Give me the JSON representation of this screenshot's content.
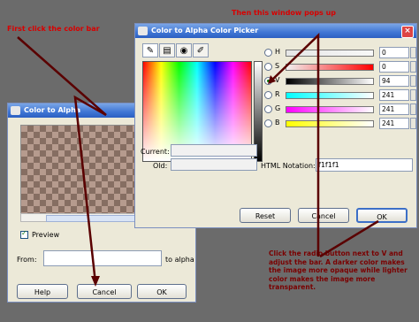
{
  "annotations": {
    "step1": "First click the color bar",
    "step2": "Then this window pops up",
    "step3": "Click the radio button next to V and adjust the bar. A darker color makes the image more opaque while lighter color makes the image more transparent."
  },
  "back_window": {
    "title": "Color to Alpha",
    "preview_label": "Preview",
    "from_label": "From:",
    "to_alpha_label": "to alpha",
    "help_button": "Help",
    "cancel_button": "Cancel",
    "ok_button": "OK"
  },
  "front_window": {
    "title": "Color to Alpha Color Picker",
    "close_glyph": "×",
    "channels": [
      {
        "label": "H",
        "value": "0"
      },
      {
        "label": "S",
        "value": "0"
      },
      {
        "label": "V",
        "value": "94"
      },
      {
        "label": "R",
        "value": "241"
      },
      {
        "label": "G",
        "value": "241"
      },
      {
        "label": "B",
        "value": "241"
      }
    ],
    "current_label": "Current:",
    "old_label": "Old:",
    "html_notation_label": "HTML Notation:",
    "html_notation_value": "f1f1f1",
    "reset_button": "Reset",
    "cancel_button": "Cancel",
    "ok_button": "OK"
  },
  "colors": {
    "annotation_red": "#d80000",
    "titlebar_blue": "#3f76d4",
    "selected_color": "#f1f1f1"
  }
}
